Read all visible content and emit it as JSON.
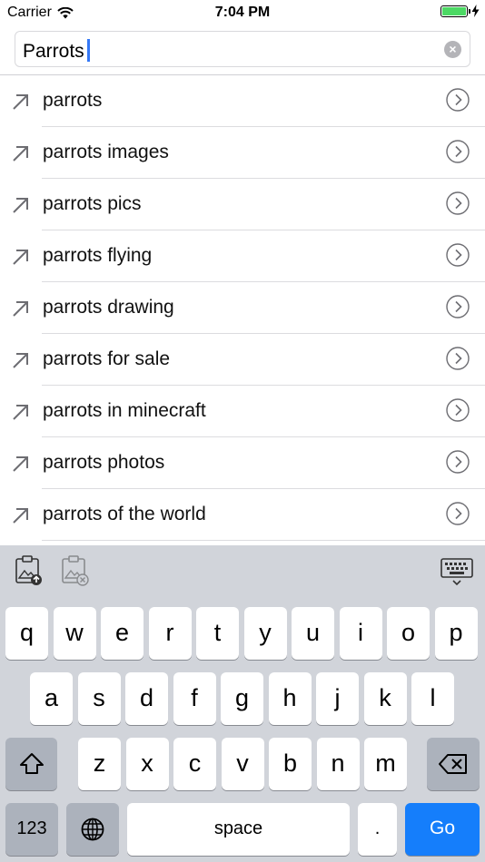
{
  "status_bar": {
    "carrier": "Carrier",
    "time": "7:04 PM",
    "battery_level": 1.0,
    "battery_color": "#4cd964"
  },
  "search": {
    "value": "Parrots",
    "clear_icon": "clear-icon"
  },
  "suggestions": [
    {
      "text": "parrots"
    },
    {
      "text": "parrots images"
    },
    {
      "text": "parrots pics"
    },
    {
      "text": "parrots flying"
    },
    {
      "text": "parrots drawing"
    },
    {
      "text": "parrots for sale"
    },
    {
      "text": "parrots in minecraft"
    },
    {
      "text": "parrots photos"
    },
    {
      "text": "parrots of the world"
    }
  ],
  "keyboard": {
    "toolbar": {
      "left_icons": [
        "paste-image-icon",
        "clear-image-icon"
      ],
      "right_icon": "keyboard-icon"
    },
    "row1": [
      "q",
      "w",
      "e",
      "r",
      "t",
      "y",
      "u",
      "i",
      "o",
      "p"
    ],
    "row2": [
      "a",
      "s",
      "d",
      "f",
      "g",
      "h",
      "j",
      "k",
      "l"
    ],
    "row3": [
      "z",
      "x",
      "c",
      "v",
      "b",
      "n",
      "m"
    ],
    "numbers_label": "123",
    "space_label": "space",
    "period_label": ".",
    "go_label": "Go",
    "accent_color": "#157efb"
  }
}
